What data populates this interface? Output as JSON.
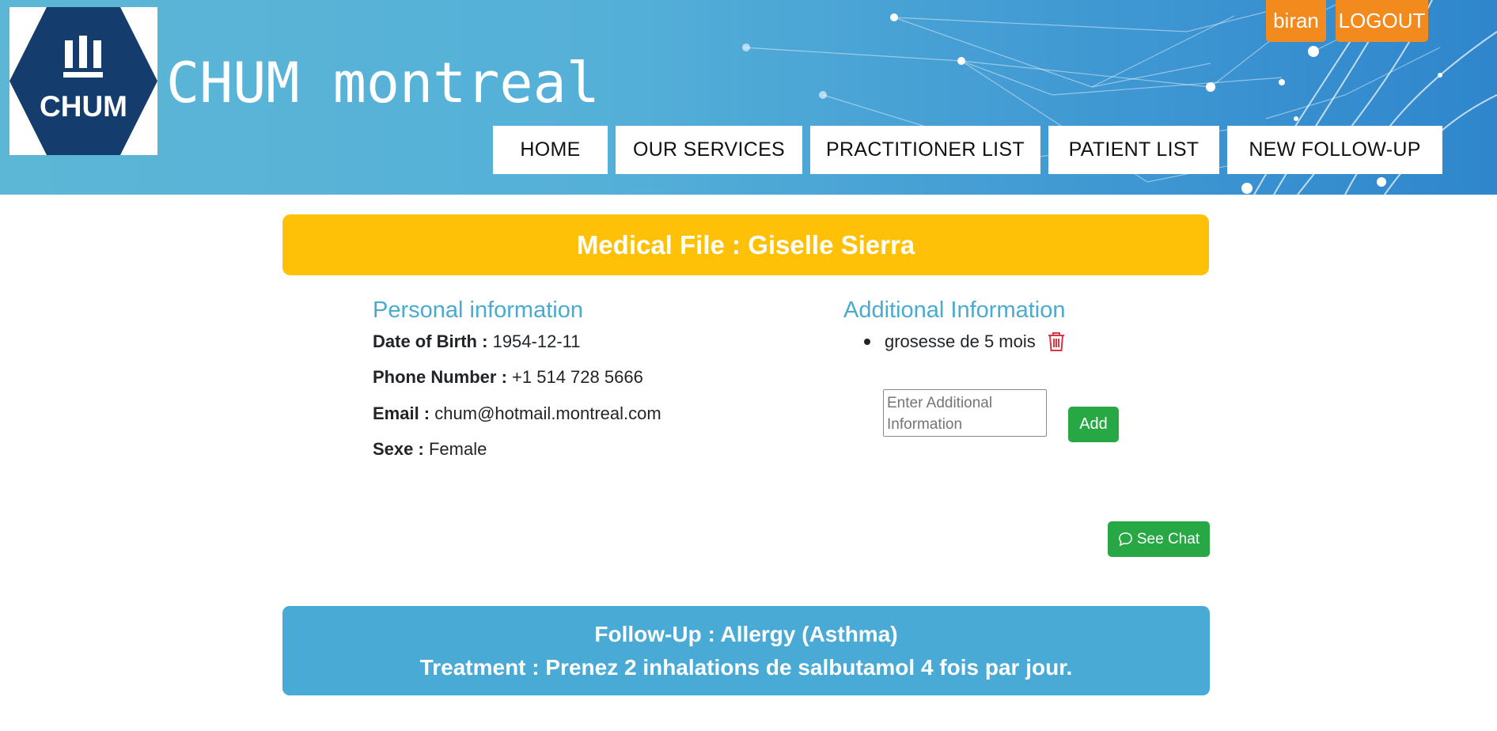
{
  "header": {
    "site_title": "CHUM montreal",
    "logo_text": "CHUM",
    "user_button": "biran",
    "logout_button": "LOGOUT",
    "nav": [
      "HOME",
      "OUR SERVICES",
      "PRACTITIONER LIST",
      "PATIENT LIST",
      "NEW FOLLOW-UP"
    ]
  },
  "medical_file": {
    "title": "Medical File : Giselle Sierra"
  },
  "personal": {
    "heading": "Personal information",
    "dob_label": "Date of Birth :",
    "dob_value": "1954-12-11",
    "phone_label": "Phone Number :",
    "phone_value": "+1 514 728 5666",
    "email_label": "Email :",
    "email_value": "chum@hotmail.montreal.com",
    "sex_label": "Sexe :",
    "sex_value": "Female"
  },
  "additional": {
    "heading": "Additional Information",
    "items": [
      "grosesse de 5 mois"
    ],
    "input_placeholder": "Enter Additional Information",
    "add_button": "Add"
  },
  "chat": {
    "button": "See Chat"
  },
  "followup": {
    "title": "Follow-Up : Allergy (Asthma)",
    "treatment": "Treatment : Prenez 2 inhalations de salbutamol 4 fois par jour."
  },
  "colors": {
    "accent_orange": "#f28a1e",
    "header_yellow": "#ffc107",
    "heading_blue": "#4aaad0",
    "button_green": "#28a745",
    "followup_blue": "#4aaad6",
    "logo_navy": "#143d6e",
    "trash_red": "#dc3545"
  },
  "icons": {
    "trash": "trash-icon",
    "chat": "chat-bubble-icon"
  }
}
